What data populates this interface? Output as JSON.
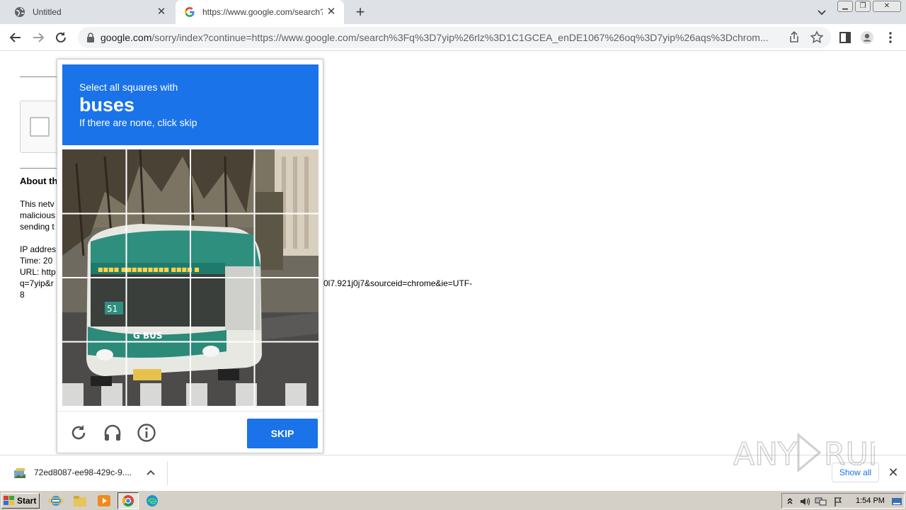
{
  "tabs": [
    {
      "title": "Untitled",
      "favicon": "globe-icon"
    },
    {
      "title": "https://www.google.com/search?q=",
      "favicon": "google-g-icon",
      "active": true
    }
  ],
  "address": {
    "host": "google.com",
    "path": "/sorry/index?continue=https://www.google.com/search%3Fq%3D7yip%26rlz%3D1C1GCEA_enDE1067%26oq%3D7yip%26aqs%3Dchrom..."
  },
  "page": {
    "about_heading": "About th",
    "para_line1": "This netv",
    "para_line2": "malicious",
    "para_line3": "sending t",
    "ip_line": "IP addres",
    "time_line": "Time: 20",
    "url_line": "URL: http",
    "q_line": "q=7yip&r",
    "trail_line": "0l7.921j0j7&sourceid=chrome&ie=UTF-",
    "eight_line": "8"
  },
  "captcha": {
    "instruction": "Select all squares with",
    "object": "buses",
    "hint": "If there are none, click skip",
    "skip_label": "SKIP",
    "accent": "#1a73e8"
  },
  "download": {
    "filename": "72ed8087-ee98-429c-9....",
    "show_all": "Show all"
  },
  "taskbar": {
    "start_label": "Start",
    "clock": "1:54 PM"
  },
  "watermark": "ANY RUN"
}
